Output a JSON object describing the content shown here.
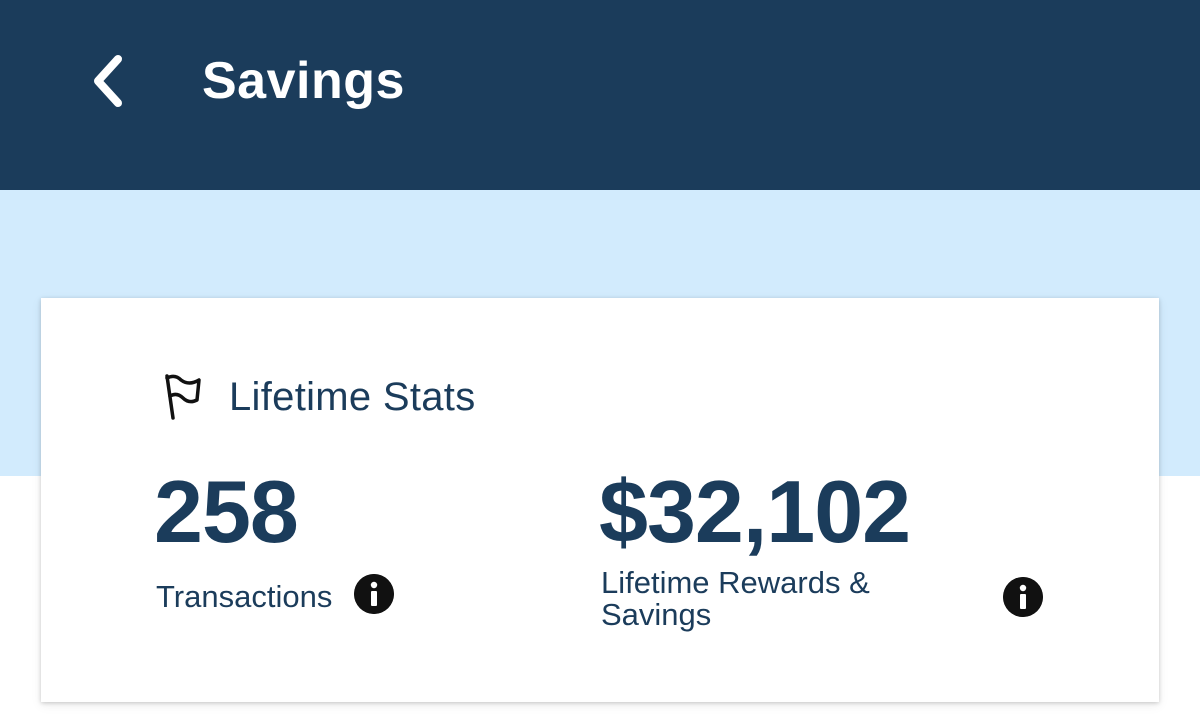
{
  "header": {
    "back_icon": "chevron-left-icon",
    "title": "Savings"
  },
  "colors": {
    "header_bg": "#1b3c5b",
    "band_bg": "#d2ebfd",
    "text_primary": "#1b3c5b",
    "info_icon": "#111111"
  },
  "lifetime_stats": {
    "icon": "flag-icon",
    "title": "Lifetime Stats",
    "transactions": {
      "value": "258",
      "label": "Transactions",
      "info_icon": "info-icon"
    },
    "rewards": {
      "value": "$32,102",
      "label_line1": "Lifetime Rewards &",
      "label_line2": "Savings",
      "info_icon": "info-icon"
    }
  }
}
